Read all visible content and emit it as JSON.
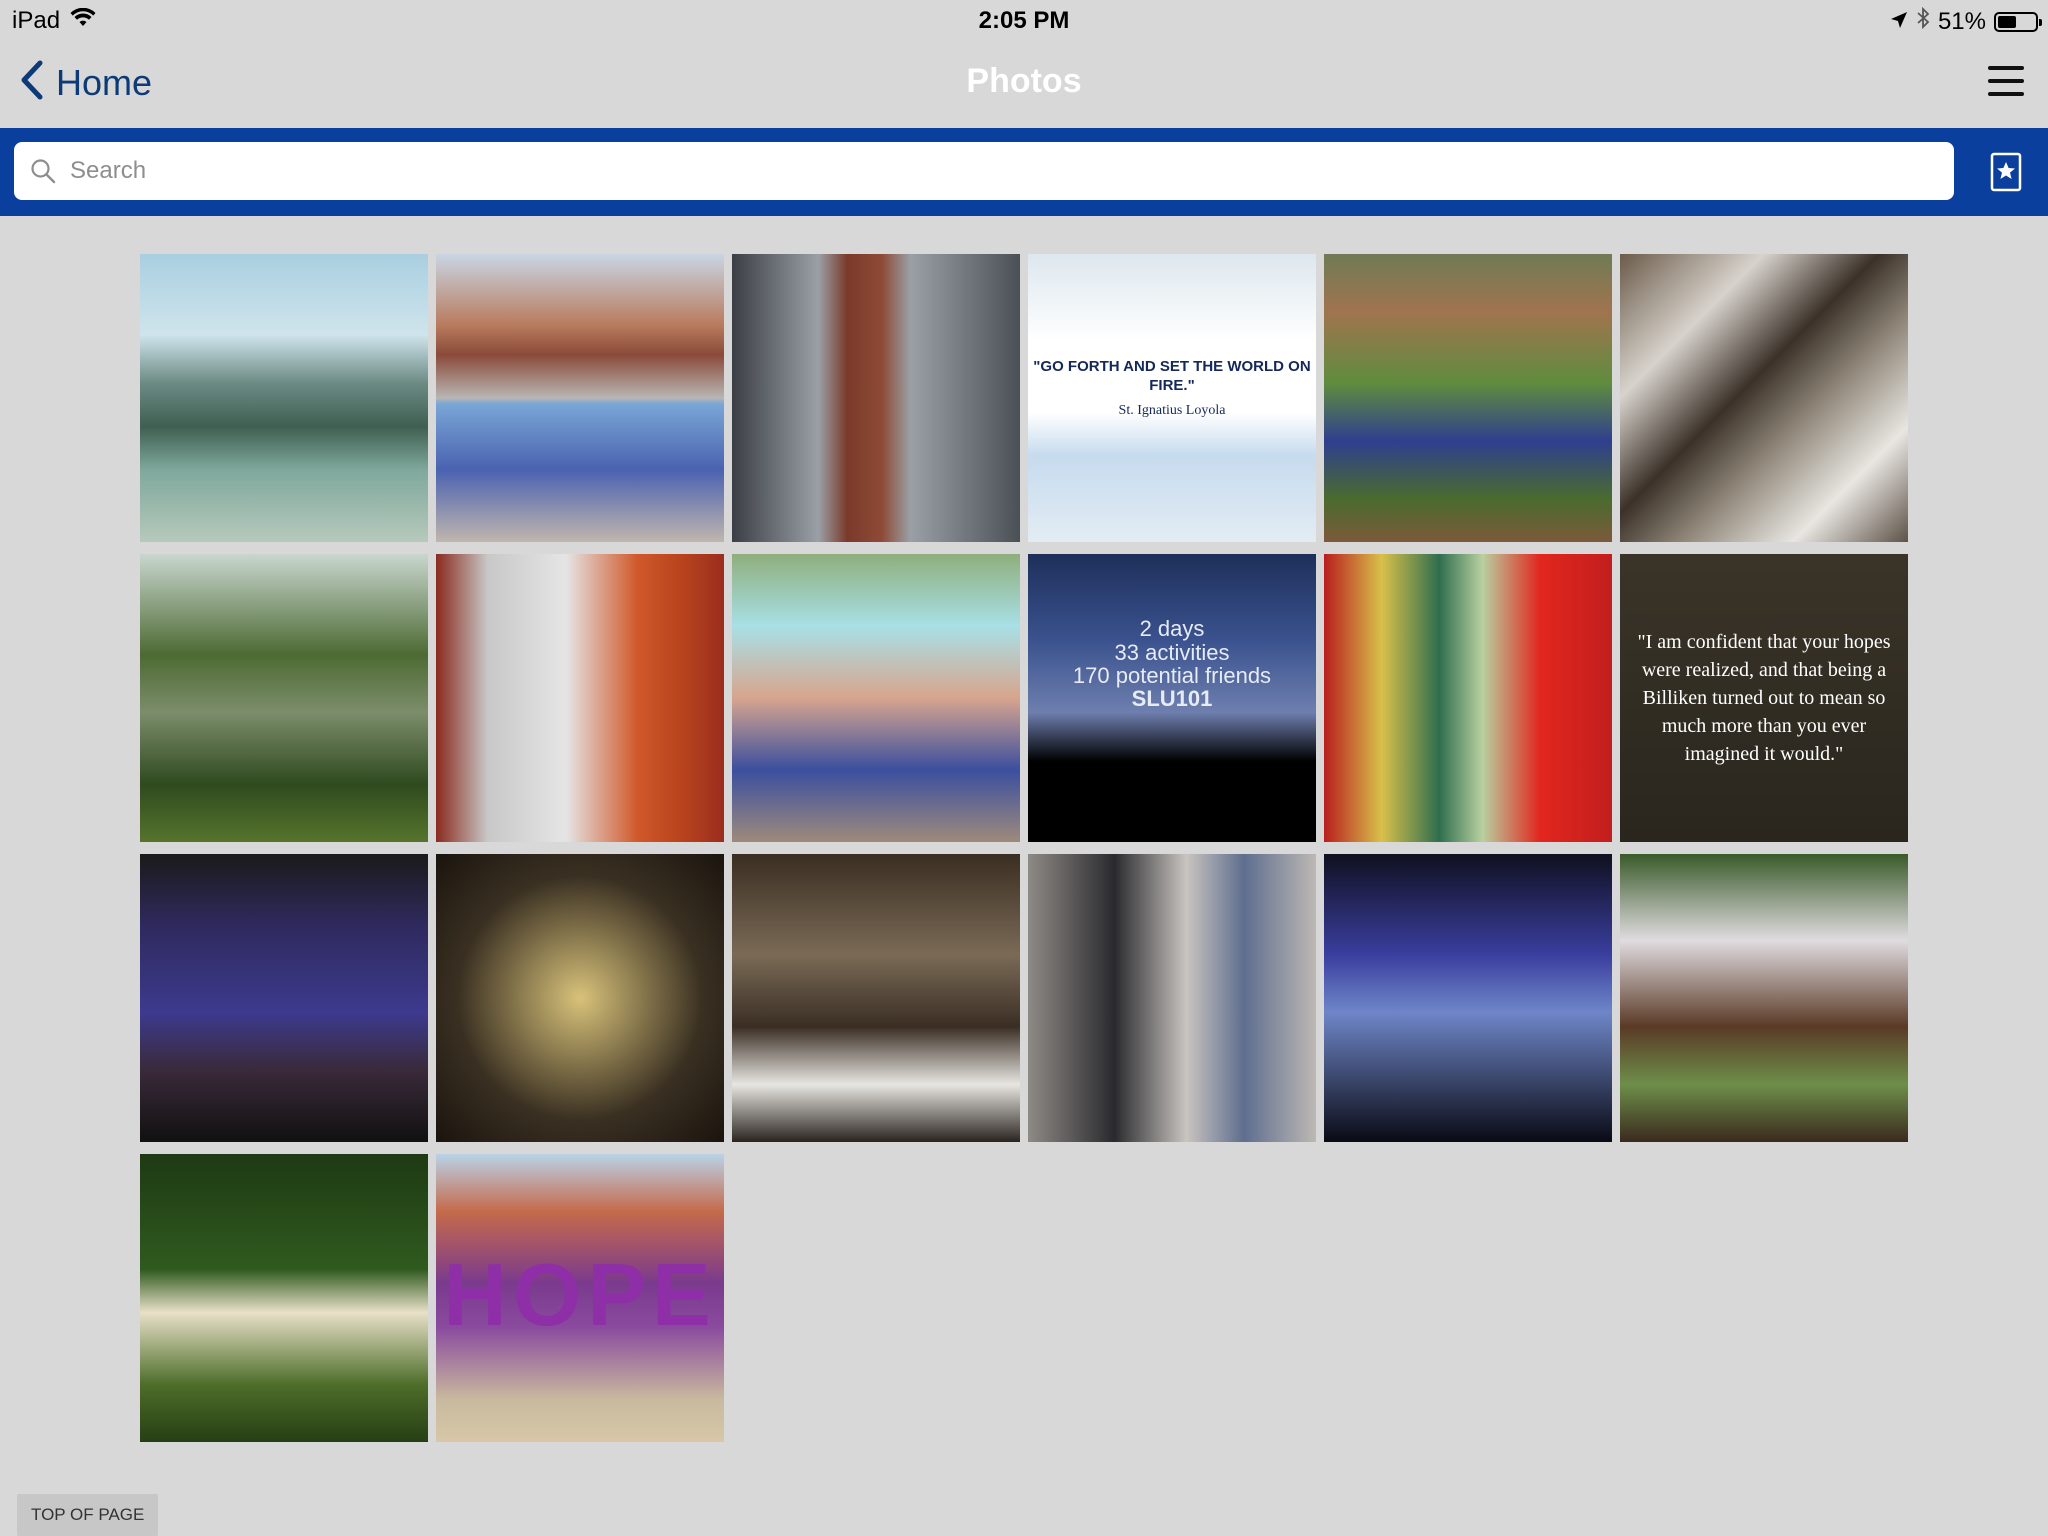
{
  "status_bar": {
    "device": "iPad",
    "time": "2:05 PM",
    "battery_percent": "51%",
    "battery_level": 0.51,
    "icons": [
      "wifi-icon",
      "location-icon",
      "bluetooth-icon",
      "battery-icon"
    ]
  },
  "nav": {
    "back_label": "Home",
    "title": "Photos"
  },
  "search": {
    "placeholder": "Search",
    "value": ""
  },
  "colors": {
    "background": "#d8d8d8",
    "search_band": "#0b3f9e",
    "nav_back": "#0c3b78"
  },
  "photos": [
    {
      "caption": ""
    },
    {
      "caption": ""
    },
    {
      "caption": ""
    },
    {
      "caption": "\"GO FORTH AND SET THE WORLD ON FIRE.\"",
      "sub": "St. Ignatius Loyola"
    },
    {
      "caption": ""
    },
    {
      "caption": ""
    },
    {
      "caption": ""
    },
    {
      "caption": ""
    },
    {
      "caption": ""
    },
    {
      "lines": [
        "2 days",
        "33 activities",
        "170 potential friends",
        "SLU101"
      ]
    },
    {
      "caption": ""
    },
    {
      "caption": "\"I am confident that your hopes were realized, and that being a Billiken turned out to mean so much more than you ever imagined it would.\""
    },
    {
      "caption": ""
    },
    {
      "caption": ""
    },
    {
      "caption": ""
    },
    {
      "caption": ""
    },
    {
      "caption": ""
    },
    {
      "caption": ""
    },
    {
      "caption": ""
    },
    {
      "caption": "HOPE"
    }
  ],
  "footer": {
    "top_of_page": "TOP OF PAGE"
  }
}
